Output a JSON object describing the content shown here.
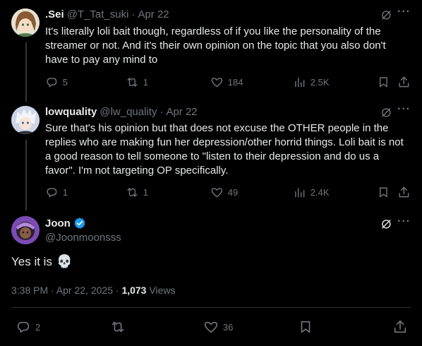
{
  "replies": [
    {
      "display_name": ".Sei",
      "handle": "@T_Tat_suki",
      "date": "Apr 22",
      "text": "It's literally loli bait though, regardless of if you like the personality of the streamer or not. And it's their own opinion on the topic that you also don't have to pay any mind to",
      "replies_count": "5",
      "reposts_count": "1",
      "likes_count": "184",
      "views_count": "2.5K"
    },
    {
      "display_name": "lowquality",
      "handle": "@lw_quality",
      "date": "Apr 22",
      "text": "Sure that's his opinion but that does not excuse the OTHER people in the replies who are making fun her depression/other horrid things. Loli bait is not a good reason to tell someone to \"listen to their depression and do us a favor\". I'm not targeting OP specifically.",
      "replies_count": "1",
      "reposts_count": "1",
      "likes_count": "49",
      "views_count": "2.4K"
    }
  ],
  "main_post": {
    "display_name": "Joon",
    "handle": "@Joonmoonsss",
    "text": "Yes it is",
    "emoji": "💀",
    "timestamp": "3:38 PM · Apr 22, 2025",
    "separator": " · ",
    "views_count": "1,073",
    "views_label": " Views",
    "replies_count": "2",
    "likes_count": "36"
  },
  "icons": {
    "reply": "reply-icon",
    "repost": "repost-icon",
    "like": "heart-icon",
    "views": "analytics-icon",
    "bookmark": "bookmark-icon",
    "share": "share-icon",
    "grok": "grok-icon",
    "more": "more-icon",
    "verified": "verified-badge-icon"
  },
  "colors": {
    "background": "#000000",
    "text": "#e7e9ea",
    "muted": "#71767b",
    "verified": "#1d9bf0",
    "divider": "#2f3336"
  }
}
